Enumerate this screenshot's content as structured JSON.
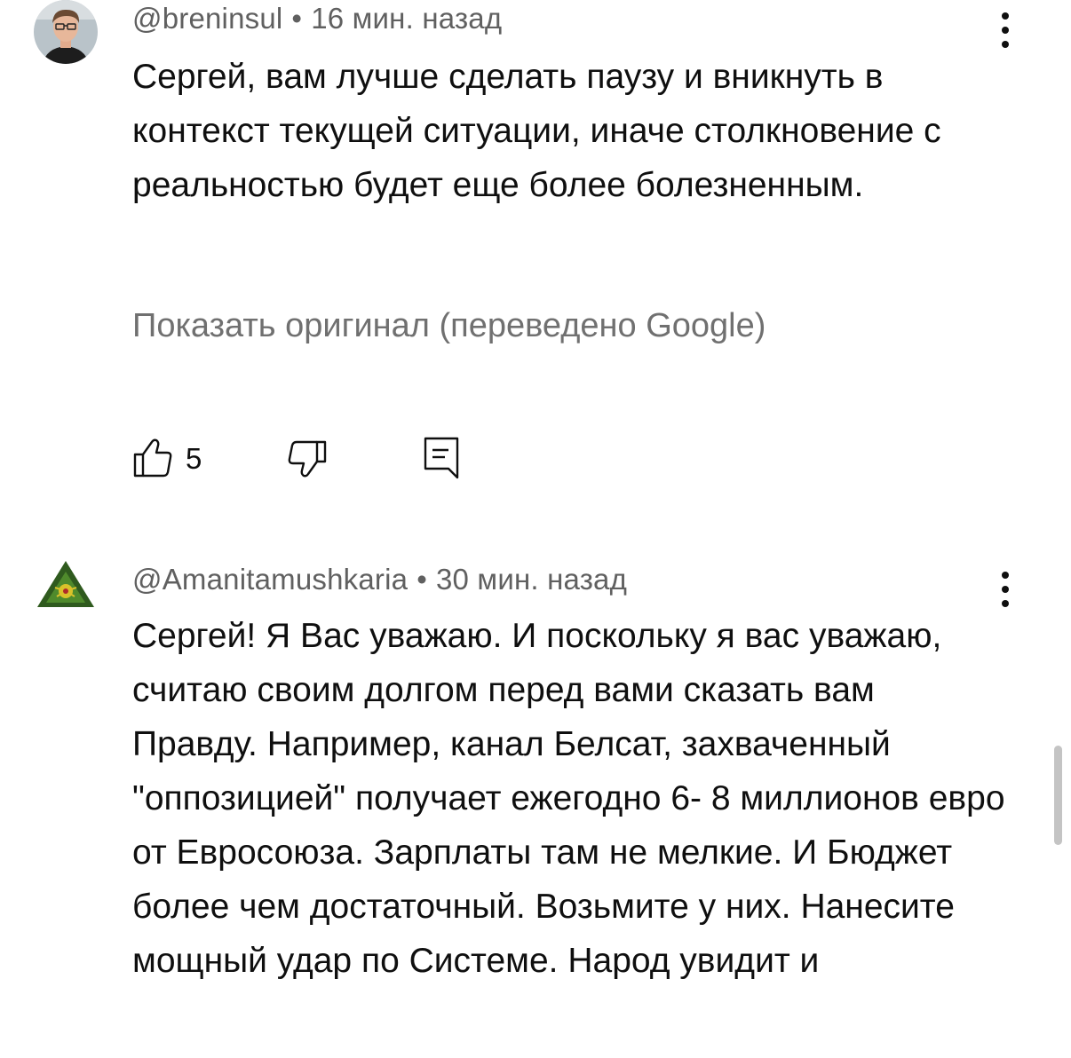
{
  "comments": [
    {
      "author": "@breninsul",
      "time": "16 мин. назад",
      "text": "Сергей, вам лучше сделать паузу и вникнуть в контекст текущей ситуации, иначе столкновение с реальностью будет еще более болезненным.",
      "show_original": "Показать оригинал (переведено Google)",
      "like_count": "5",
      "avatar_icon": "person-photo-avatar",
      "avatar_colors": {
        "bg": "#b9c3c9",
        "skin": "#e7b79a",
        "hair": "#6a4a33",
        "shirt": "#1d1d1d"
      }
    },
    {
      "author": "@Amanitamushkaria",
      "time": "30 мин. назад",
      "text": "Сергей! Я Вас уважаю. И поскольку я вас уважаю, считаю своим долгом перед вами сказать вам Правду. Например, канал Белсат, захваченный \"оппозицией\" получает ежегодно 6- 8 миллионов евро от Евросоюза. Зарплаты там не мелкие. И Бюджет более чем достаточный. Возьмите у них. Нанесите мощный удар по Системе. Народ увидит и",
      "avatar_icon": "triangle-emblem-avatar",
      "avatar_colors": {
        "outer": "#2f5a1e",
        "inner": "#4f8a2c",
        "mark": "#d9c22a"
      }
    }
  ],
  "separator_dot": "•",
  "colors": {
    "text": "#0f0f0f",
    "meta": "#606060",
    "show_original": "#707070",
    "scrollbar": "#c4c4c4"
  }
}
